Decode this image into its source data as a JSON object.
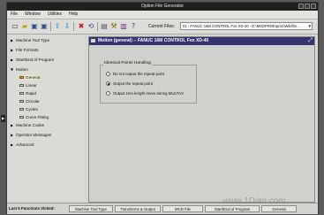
{
  "window": {
    "title": "Option File Generator"
  },
  "menu": [
    "File",
    "Window",
    "Utilities",
    "Help"
  ],
  "toolbar": {
    "icons": [
      "new-file-icon",
      "open-folder-icon",
      "save-icon",
      "save-as-icon",
      "upload-icon",
      "download-icon",
      "delete-icon",
      "refresh-icon",
      "export-icon",
      "settings-icon",
      "compare-icon",
      "help-icon"
    ],
    "current_files_label": "Current Files:",
    "current_file_value": "01 - FANUC 16M CONTROL Fox XD-40 - D:\\MSDPROE\\proe\\Wildfire..."
  },
  "sidebar": {
    "items": [
      {
        "label": "Machine Tool Type",
        "level": 0,
        "expanded": false
      },
      {
        "label": "File Formats",
        "level": 0,
        "expanded": false
      },
      {
        "label": "Start/End of Program",
        "level": 0,
        "expanded": false
      },
      {
        "label": "Motion",
        "level": 0,
        "expanded": true
      },
      {
        "label": "General",
        "level": 1,
        "selected": true
      },
      {
        "label": "Linear",
        "level": 1
      },
      {
        "label": "Rapid",
        "level": 1
      },
      {
        "label": "Circular",
        "level": 1
      },
      {
        "label": "Cycles",
        "level": 1
      },
      {
        "label": "Curve Fitting",
        "level": 1
      },
      {
        "label": "Machine Codes",
        "level": 0,
        "expanded": false
      },
      {
        "label": "Operator Messages",
        "level": 0,
        "expanded": false
      },
      {
        "label": "Advanced",
        "level": 0,
        "expanded": false
      }
    ]
  },
  "panel": {
    "title": "Motion (general) -- FANUC 16M CONTROL Fox XD-40",
    "group_title": "Identical Points Handling",
    "options": [
      {
        "label": "Do not output the repeat point",
        "selected": false
      },
      {
        "label": "Output the repeat point",
        "selected": true
      },
      {
        "label": "Output zero length move during MULTAX",
        "selected": false
      }
    ]
  },
  "status": {
    "label": "Last 5 Functions Visited:",
    "tabs": [
      "Machine Tool Type",
      "Transforms & Output",
      "MCD File",
      "Start/End of Program",
      "General"
    ]
  },
  "watermark": "www.1Dian.com"
}
